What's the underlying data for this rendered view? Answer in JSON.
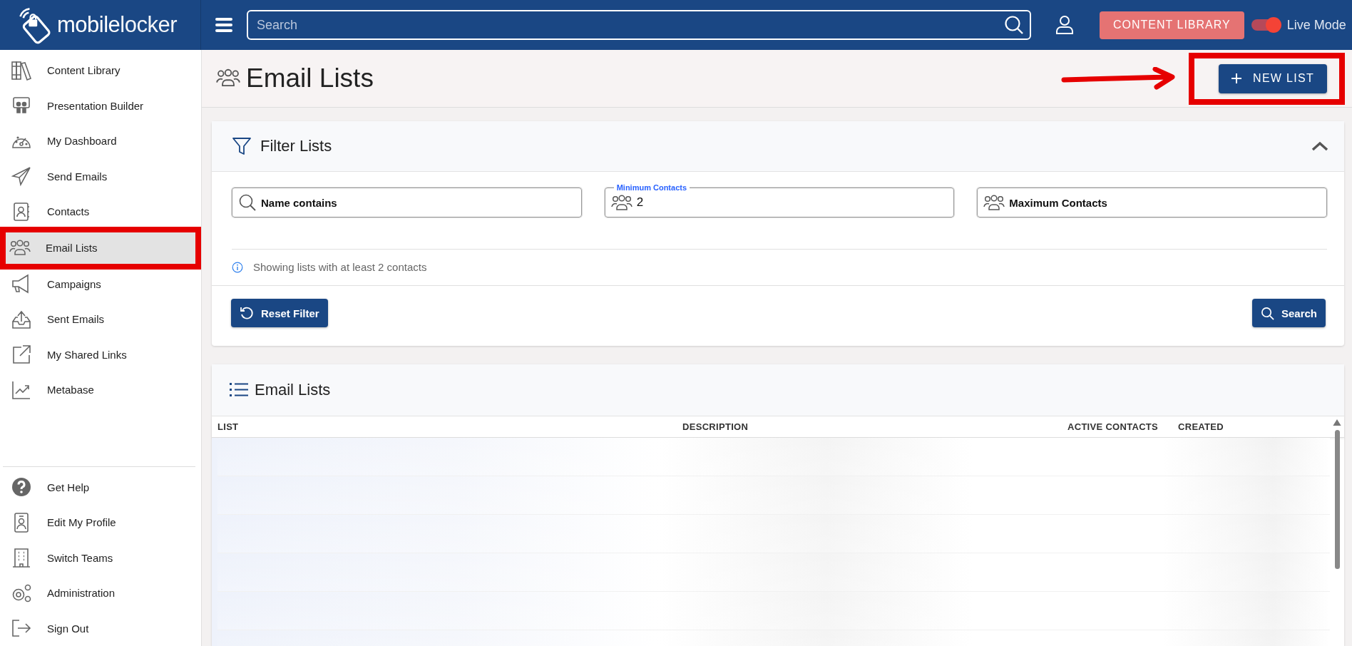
{
  "topbar": {
    "logo": {
      "first": "mobile",
      "second": "locker"
    },
    "search": {
      "placeholder": "Search"
    },
    "content_library_button": "CONTENT LIBRARY",
    "live_mode": {
      "label": "Live Mode",
      "on": true
    }
  },
  "sidebar": {
    "items": [
      {
        "label": "Content Library",
        "selected": false,
        "highlighted": false
      },
      {
        "label": "Presentation Builder",
        "selected": false,
        "highlighted": false
      },
      {
        "label": "My Dashboard",
        "selected": false,
        "highlighted": false
      },
      {
        "label": "Send Emails",
        "selected": false,
        "highlighted": false
      },
      {
        "label": "Contacts",
        "selected": false,
        "highlighted": false
      },
      {
        "label": "Email Lists",
        "selected": true,
        "highlighted": true
      },
      {
        "label": "Campaigns",
        "selected": false,
        "highlighted": false
      },
      {
        "label": "Sent Emails",
        "selected": false,
        "highlighted": false
      },
      {
        "label": "My Shared Links",
        "selected": false,
        "highlighted": false
      },
      {
        "label": "Metabase",
        "selected": false,
        "highlighted": false
      }
    ],
    "bottom_items": [
      {
        "label": "Get Help"
      },
      {
        "label": "Edit My Profile"
      },
      {
        "label": "Switch Teams"
      },
      {
        "label": "Administration"
      },
      {
        "label": "Sign Out"
      }
    ]
  },
  "page": {
    "title": "Email Lists",
    "new_list_button": {
      "label": "NEW LIST",
      "highlighted": true
    }
  },
  "filter": {
    "title": "Filter Lists",
    "expanded": true,
    "fields": [
      {
        "label": "Name contains"
      },
      {
        "label": "Minimum Contacts",
        "value": "2"
      },
      {
        "label": "Maximum Contacts"
      }
    ],
    "info": "Showing lists with at least 2 contacts",
    "reset_button": "Reset Filter",
    "search_button": "Search"
  },
  "lists": {
    "title": "Email Lists",
    "columns": [
      "LIST",
      "DESCRIPTION",
      "ACTIVE CONTACTS",
      "CREATED"
    ]
  }
}
